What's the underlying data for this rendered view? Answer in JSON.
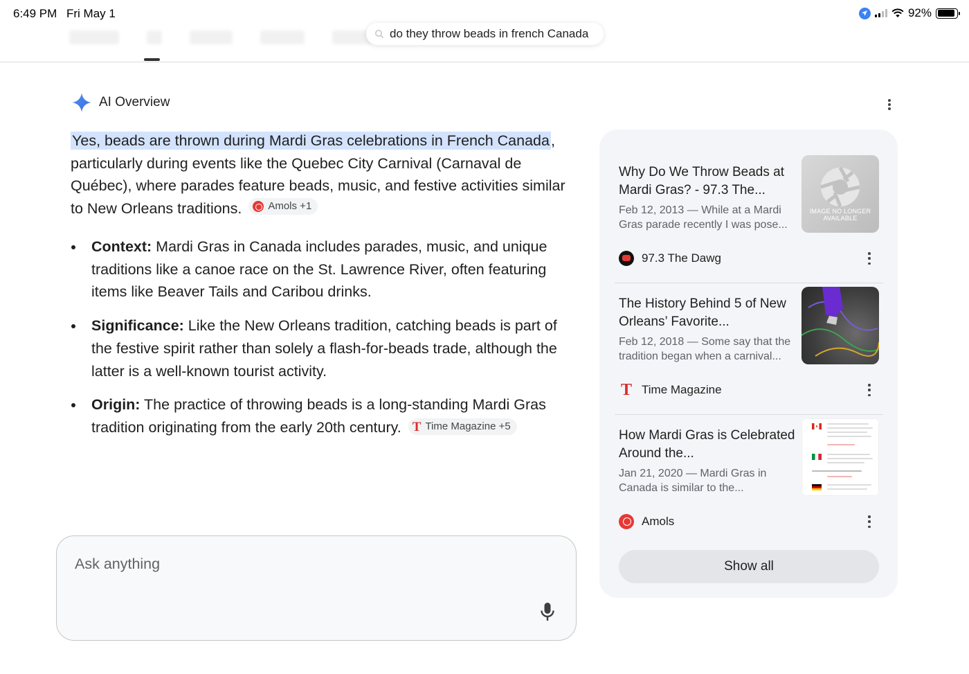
{
  "status_bar": {
    "time": "6:49 PM",
    "date": "Fri May 1",
    "battery": "92%",
    "battery_level": 0.92,
    "icons": [
      "location-icon",
      "signal-icon",
      "wifi-icon",
      "battery-icon"
    ]
  },
  "search": {
    "query": "do they throw beads in french Canada"
  },
  "ai_overview": {
    "title": "AI Overview",
    "answer_highlight": "Yes, beads are thrown during Mardi Gras celebrations in French Canada",
    "answer_rest": ", particularly during events like the Quebec City Carnival (Carnaval de Québec), where parades feature beads, music, and festive activities similar to New Orleans traditions.",
    "answer_chip": "Amols +1",
    "bullets": [
      {
        "term": "Context:",
        "text": " Mardi Gras in Canada includes parades, music, and unique traditions like a canoe race on the St. Lawrence River, often featuring items like Beaver Tails and Caribou drinks."
      },
      {
        "term": "Significance:",
        "text": " Like the New Orleans tradition, catching beads is part of the festive spirit rather than solely a flash-for-beads trade, although the latter is a well-known tourist activity."
      },
      {
        "term": "Origin:",
        "text": " The practice of throwing beads is a long-standing Mardi Gras tradition originating from the early 20th century.",
        "chip": "Time Magazine +5"
      }
    ]
  },
  "ask": {
    "placeholder": "Ask anything"
  },
  "sources": {
    "items": [
      {
        "title": "Why Do We Throw Beads at Mardi Gras? - 97.3 The...",
        "snippet": "Feb 12, 2013 — While at a Mardi Gras parade recently I was pose...",
        "source": "97.3 The Dawg",
        "thumb_text": "IMAGE NO LONGER AVAILABLE"
      },
      {
        "title": "The History Behind 5 of New Orleans’ Favorite...",
        "snippet": "Feb 12, 2018 — Some say that the tradition began when a carnival...",
        "source": "Time Magazine"
      },
      {
        "title": "How Mardi Gras is Celebrated Around the...",
        "snippet": "Jan 21, 2020 — Mardi Gras in Canada is similar to the...",
        "source": "Amols"
      }
    ],
    "show_all": "Show all"
  }
}
